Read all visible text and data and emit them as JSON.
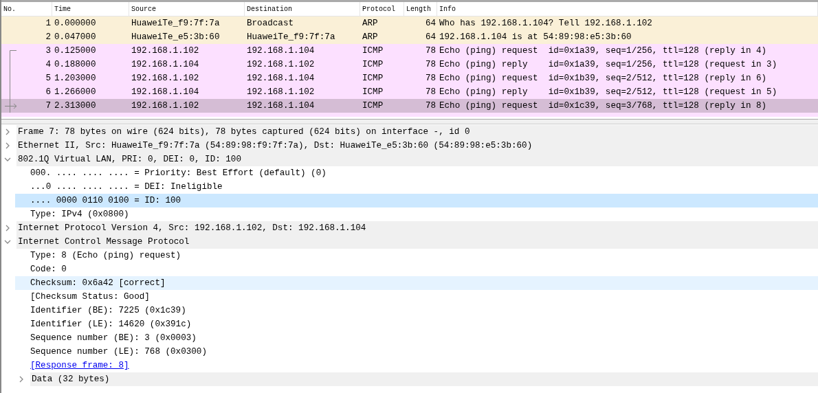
{
  "packet_list": {
    "columns": [
      "No.",
      "Time",
      "Source",
      "Destination",
      "Protocol",
      "Length",
      "Info"
    ],
    "rows": [
      {
        "cells": [
          "1",
          "0.000000",
          "HuaweiTe_f9:7f:7a",
          "Broadcast",
          "ARP",
          "64",
          "Who has 192.168.1.104? Tell 192.168.1.102"
        ],
        "kind": "arp",
        "selected": false,
        "in_conversation": false
      },
      {
        "cells": [
          "2",
          "0.047000",
          "HuaweiTe_e5:3b:60",
          "HuaweiTe_f9:7f:7a",
          "ARP",
          "64",
          "192.168.1.104 is at 54:89:98:e5:3b:60"
        ],
        "kind": "arp",
        "selected": false,
        "in_conversation": false
      },
      {
        "cells": [
          "3",
          "0.125000",
          "192.168.1.102",
          "192.168.1.104",
          "ICMP",
          "78",
          "Echo (ping) request  id=0x1a39, seq=1/256, ttl=128 (reply in 4)"
        ],
        "kind": "icmp",
        "selected": false,
        "in_conversation": true
      },
      {
        "cells": [
          "4",
          "0.188000",
          "192.168.1.104",
          "192.168.1.102",
          "ICMP",
          "78",
          "Echo (ping) reply    id=0x1a39, seq=1/256, ttl=128 (request in 3)"
        ],
        "kind": "icmp",
        "selected": false,
        "in_conversation": true
      },
      {
        "cells": [
          "5",
          "1.203000",
          "192.168.1.102",
          "192.168.1.104",
          "ICMP",
          "78",
          "Echo (ping) request  id=0x1b39, seq=2/512, ttl=128 (reply in 6)"
        ],
        "kind": "icmp",
        "selected": false,
        "in_conversation": true
      },
      {
        "cells": [
          "6",
          "1.266000",
          "192.168.1.104",
          "192.168.1.102",
          "ICMP",
          "78",
          "Echo (ping) reply    id=0x1b39, seq=2/512, ttl=128 (request in 5)"
        ],
        "kind": "icmp",
        "selected": false,
        "in_conversation": true
      },
      {
        "cells": [
          "7",
          "2.313000",
          "192.168.1.102",
          "192.168.1.104",
          "ICMP",
          "78",
          "Echo (ping) request  id=0x1c39, seq=3/768, ttl=128 (reply in 8)"
        ],
        "kind": "icmp",
        "selected": true,
        "in_conversation": true
      }
    ]
  },
  "details": [
    {
      "text": "Frame 7: 78 bytes on wire (624 bits), 78 bytes captured (624 bits) on interface -, id 0",
      "expanded": false
    },
    {
      "text": "Ethernet II, Src: HuaweiTe_f9:7f:7a (54:89:98:f9:7f:7a), Dst: HuaweiTe_e5:3b:60 (54:89:98:e5:3b:60)",
      "expanded": false
    },
    {
      "text": "802.1Q Virtual LAN, PRI: 0, DEI: 0, ID: 100",
      "expanded": true,
      "children": [
        {
          "text": "000. .... .... .... = Priority: Best Effort (default) (0)",
          "selected": false,
          "highlighted": false
        },
        {
          "text": "...0 .... .... .... = DEI: Ineligible",
          "selected": false,
          "highlighted": false
        },
        {
          "text": ".... 0000 0110 0100 = ID: 100",
          "selected": true,
          "highlighted": false
        },
        {
          "text": "Type: IPv4 (0x0800)",
          "selected": false,
          "highlighted": false
        }
      ]
    },
    {
      "text": "Internet Protocol Version 4, Src: 192.168.1.102, Dst: 192.168.1.104",
      "expanded": false
    },
    {
      "text": "Internet Control Message Protocol",
      "expanded": true,
      "children": [
        {
          "text": "Type: 8 (Echo (ping) request)",
          "selected": false,
          "highlighted": false
        },
        {
          "text": "Code: 0",
          "selected": false,
          "highlighted": false
        },
        {
          "text": "Checksum: 0x6a42 [correct]",
          "selected": false,
          "highlighted": true
        },
        {
          "text": "[Checksum Status: Good]",
          "selected": false,
          "highlighted": false
        },
        {
          "text": "Identifier (BE): 7225 (0x1c39)",
          "selected": false,
          "highlighted": false
        },
        {
          "text": "Identifier (LE): 14620 (0x391c)",
          "selected": false,
          "highlighted": false
        },
        {
          "text": "Sequence number (BE): 3 (0x0003)",
          "selected": false,
          "highlighted": false
        },
        {
          "text": "Sequence number (LE): 768 (0x0300)",
          "selected": false,
          "highlighted": false
        },
        {
          "text": "[Response frame: 8]",
          "kind": "link",
          "selected": false,
          "highlighted": false
        },
        {
          "text": "Data (32 bytes)",
          "expanded": false,
          "selected": false,
          "highlighted": false
        }
      ]
    }
  ]
}
